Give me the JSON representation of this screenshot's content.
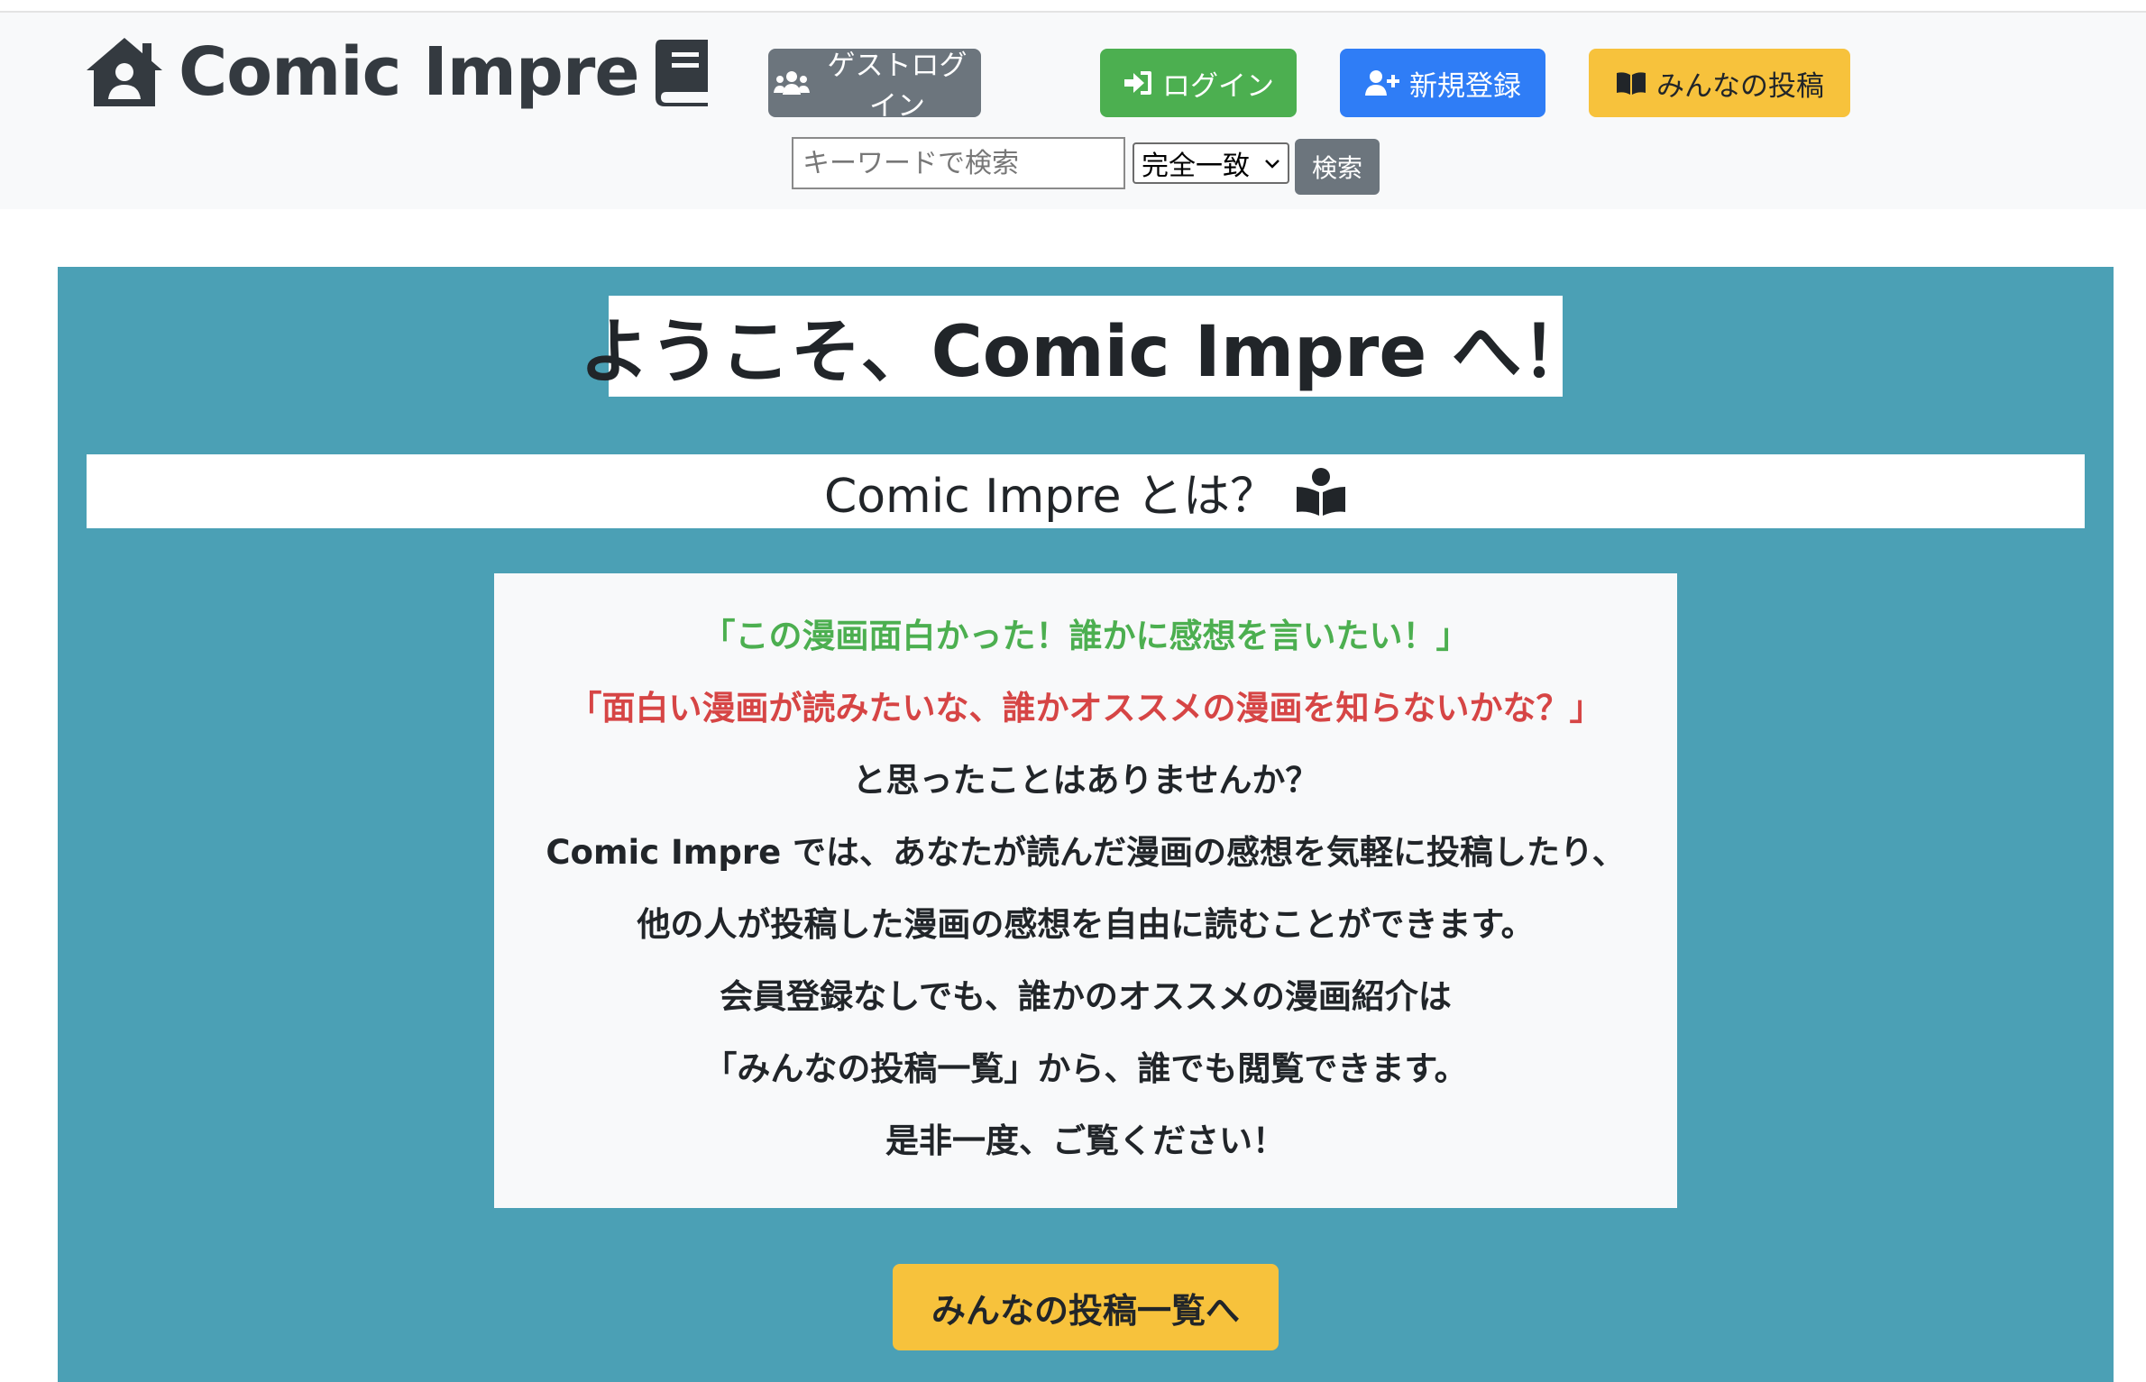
{
  "navbar": {
    "brand": "Comic Impre",
    "buttons": {
      "guest_login": "ゲストログイン",
      "login": "ログイン",
      "signup": "新規登録",
      "posts": "みんなの投稿"
    },
    "search": {
      "placeholder": "キーワードで検索",
      "match_option": "完全一致",
      "submit": "検索"
    }
  },
  "hero": {
    "welcome": "ようこそ、Comic Impre へ！",
    "about_heading": "Comic Impre とは？",
    "lines": [
      "「この漫画面白かった！誰かに感想を言いたい！」",
      "「面白い漫画が読みたいな、誰かオススメの漫画を知らないかな？」",
      "と思ったことはありませんか？",
      "Comic Impre では、あなたが読んだ漫画の感想を気軽に投稿したり、",
      "他の人が投稿した漫画の感想を自由に読むことができます。",
      "会員登録なしでも、誰かのオススメの漫画紹介は",
      "「みんなの投稿一覧」から、誰でも閲覧できます。",
      "是非一度、ご覧ください！"
    ],
    "cta": "みんなの投稿一覧へ"
  },
  "colors": {
    "hero_bg": "#4ba0b5",
    "navbar_bg": "#f8f9fa",
    "guest": "#6c757d",
    "login": "#4caf50",
    "signup": "#2f7df6",
    "posts": "#f7c23c",
    "line_green": "#4caf50",
    "line_red": "#d64545"
  },
  "icons": {
    "brand_left": "house-user-icon",
    "brand_right": "book-icon",
    "guest": "users-icon",
    "login": "sign-in-icon",
    "signup": "user-plus-icon",
    "posts": "book-open-icon",
    "about": "book-reader-icon",
    "select": "chevron-down-icon"
  }
}
